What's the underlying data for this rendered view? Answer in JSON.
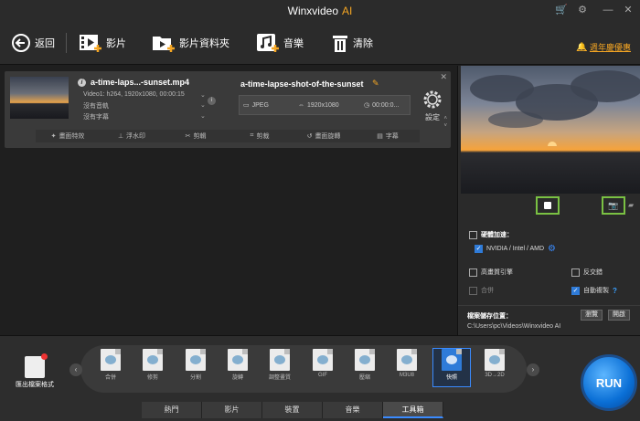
{
  "app": {
    "title": "Winxvideo",
    "title_ai": "AI"
  },
  "toolbar": {
    "back": "返回",
    "video": "影片",
    "video_folder": "影片資料夾",
    "music": "音樂",
    "clear": "清除",
    "weekly": "週年慶優惠"
  },
  "item": {
    "src_name": "a-time-laps...-sunset.mp4",
    "src_video": "Video1: h264, 1920x1080, 00:00:15",
    "src_audio": "沒有音軌",
    "src_sub": "沒有字幕",
    "out_name": "a-time-lapse-shot-of-the-sunset",
    "out_format": "JPEG",
    "out_res": "1920x1080",
    "out_dur": "00:00:0...",
    "settings": "設定",
    "edits": [
      "畫面特效",
      "浮水印",
      "剪輯",
      "剪裁",
      "畫面旋轉",
      "字幕"
    ]
  },
  "options": {
    "hw_accel": "硬體加速：",
    "hw_vendor": "NVIDIA / Intel / AMD",
    "hq_engine": "高畫質引擎",
    "deinterlace": "反交錯",
    "merge": "合併",
    "auto_copy": "自動複製",
    "save_label": "檔案儲存位置：",
    "save_path": "C:\\Users\\pc\\Videos\\Winxvideo AI",
    "browse": "瀏覽",
    "open": "開啟"
  },
  "bottom": {
    "export_format": "匯出檔案格式",
    "tools": [
      "合併",
      "修剪",
      "分割",
      "旋轉",
      "調整畫質",
      "GIF",
      "壓縮",
      "M3U8",
      "快照",
      "3D→2D"
    ],
    "active_tool": "快照",
    "tabs": [
      "熱門",
      "影片",
      "裝置",
      "音樂",
      "工具箱"
    ],
    "active_tab": "工具箱",
    "run": "RUN"
  },
  "colors": {
    "accent": "#3a8bff",
    "orange": "#f5a623",
    "green": "#7ac143"
  }
}
